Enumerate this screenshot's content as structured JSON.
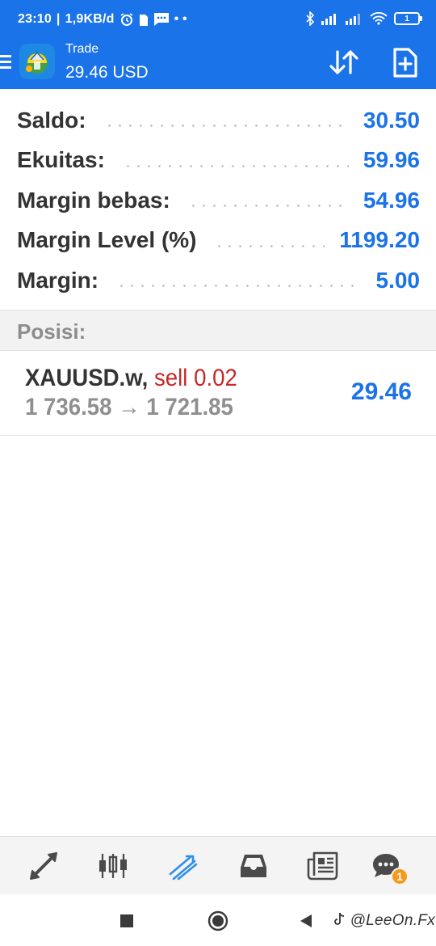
{
  "status_bar": {
    "time": "23:10",
    "net_speed": "1,9KB/d",
    "dots": "• •",
    "battery_level": "1"
  },
  "app_bar": {
    "title": "Trade",
    "subtitle": "29.46 USD"
  },
  "account": {
    "rows": [
      {
        "label": "Saldo:",
        "value": "30.50"
      },
      {
        "label": "Ekuitas:",
        "value": "59.96"
      },
      {
        "label": "Margin bebas:",
        "value": "54.96"
      },
      {
        "label": "Margin Level (%)",
        "value": "1199.20"
      },
      {
        "label": "Margin:",
        "value": "5.00"
      }
    ]
  },
  "positions": {
    "header": "Posisi:",
    "items": [
      {
        "symbol": "XAUUSD.w,",
        "type": "sell 0.02",
        "open_price": "1 736.58",
        "arrow": "→",
        "current_price": "1 721.85",
        "profit": "29.46"
      }
    ]
  },
  "bottom_nav": {
    "items": [
      {
        "icon": "quotes-icon"
      },
      {
        "icon": "chart-candles-icon"
      },
      {
        "icon": "trade-icon",
        "active": true
      },
      {
        "icon": "history-inbox-icon"
      },
      {
        "icon": "news-icon"
      },
      {
        "icon": "messages-icon",
        "badge": "1"
      }
    ]
  },
  "watermark": "@LeeOn.Fx",
  "colors": {
    "accent": "#1a73e8",
    "sell": "#c62828",
    "badge": "#f59a1b",
    "label": "#333333",
    "muted": "#8f8f8f"
  }
}
